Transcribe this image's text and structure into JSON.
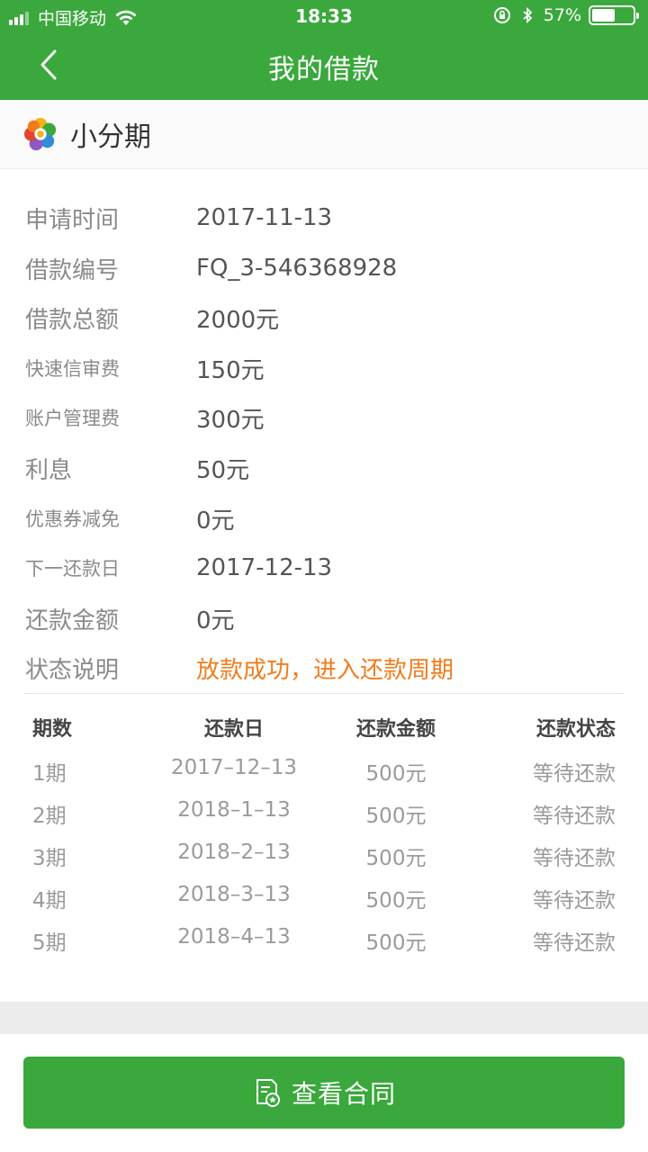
{
  "status_bar": {
    "carrier": "中国移动",
    "time": "18:33",
    "battery": "57%",
    "battery_level": 0.57
  },
  "nav": {
    "title": "我的借款",
    "back_icon": "chevron-left-icon"
  },
  "product": {
    "name": "小分期",
    "logo_icon": "flower-logo-icon"
  },
  "details": [
    {
      "label": "申请时间",
      "value": "2017-11-13"
    },
    {
      "label": "借款编号",
      "value": "FQ_3-546368928"
    },
    {
      "label": "借款总额",
      "value": "2000元"
    },
    {
      "label": "快速信审费",
      "value": "150元"
    },
    {
      "label": "账户管理费",
      "value": "300元"
    },
    {
      "label": "利息",
      "value": "50元"
    },
    {
      "label": "优惠券减免",
      "value": "0元"
    },
    {
      "label": "下一还款日",
      "value": "2017-12-13"
    },
    {
      "label": "还款金额",
      "value": "0元"
    },
    {
      "label": "状态说明",
      "value": "放款成功，进入还款周期"
    }
  ],
  "status_color": "#f07c1c",
  "table": {
    "headers": [
      "期数",
      "还款日",
      "还款金额",
      "还款状态"
    ],
    "rows": [
      [
        "1期",
        "2017–12–13",
        "500元",
        "等待还款"
      ],
      [
        "2期",
        "2018–1–13",
        "500元",
        "等待还款"
      ],
      [
        "3期",
        "2018–2–13",
        "500元",
        "等待还款"
      ],
      [
        "4期",
        "2018–3–13",
        "500元",
        "等待还款"
      ],
      [
        "5期",
        "2018–4–13",
        "500元",
        "等待还款"
      ]
    ]
  },
  "contract_button": {
    "label": "查看合同",
    "icon": "contract-document-icon"
  },
  "colors": {
    "brand_green": "#3aa83c",
    "label_gray": "#8a8a8a",
    "value_gray": "#555555"
  }
}
